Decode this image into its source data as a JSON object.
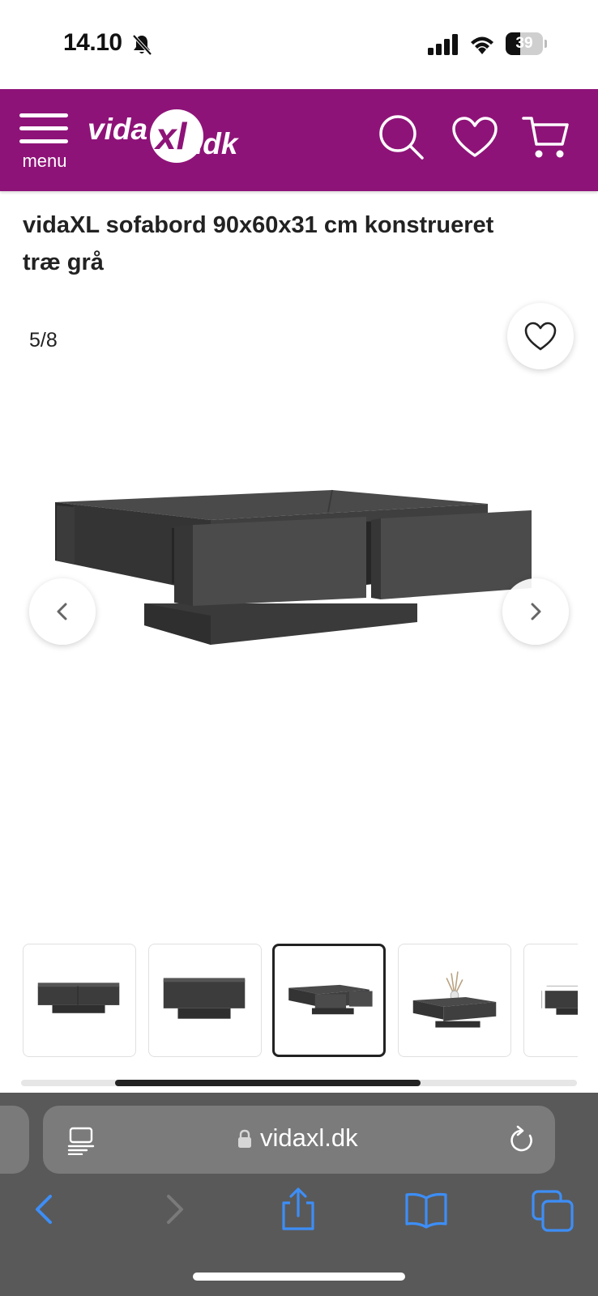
{
  "status_bar": {
    "time": "14.10",
    "battery_level": "39",
    "battery_fraction": 0.39
  },
  "header": {
    "menu_label": "menu",
    "logo_text_main": "vida",
    "logo_text_xl": "xl",
    "logo_text_tld": ".dk",
    "brand_color": "#8e1378",
    "icons": [
      "search-icon",
      "heart-icon",
      "cart-icon"
    ]
  },
  "product": {
    "title": "vidaXL sofabord 90x60x31 cm konstrueret træ grå"
  },
  "gallery": {
    "counter": "5/8",
    "current_index": 5,
    "total": 8,
    "visible_thumbnails": 5,
    "active_thumbnail": 3,
    "scroll_position_fraction": 0.25,
    "scroll_visible_fraction": 0.55
  },
  "browser": {
    "url": "vidaxl.dk",
    "toolbar_icons": [
      "back-icon",
      "forward-icon",
      "share-icon",
      "bookmarks-icon",
      "tabs-icon"
    ],
    "accent_color": "#3d8ef7"
  }
}
